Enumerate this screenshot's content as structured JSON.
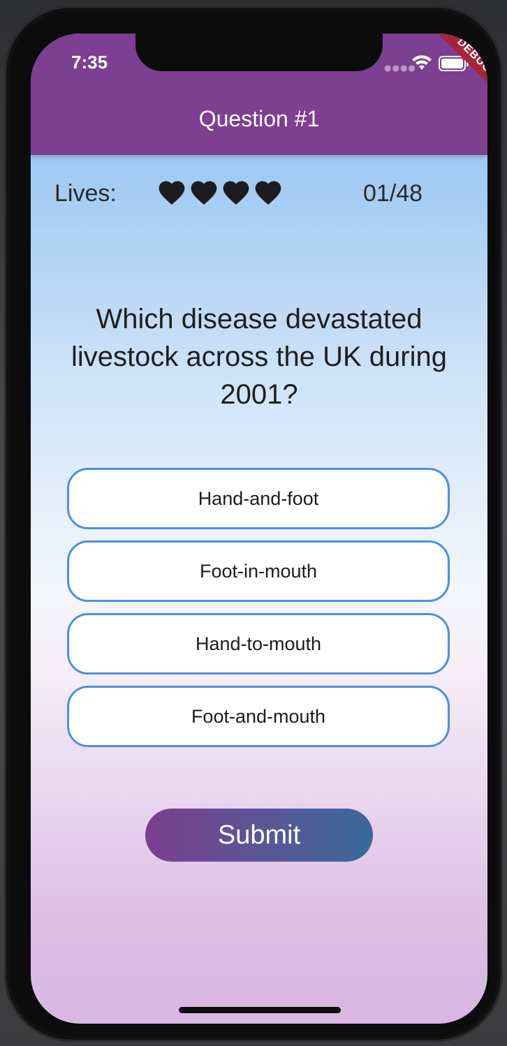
{
  "status_bar": {
    "time": "7:35",
    "icons": [
      "cellular-dots-icon",
      "wifi-icon",
      "battery-icon"
    ]
  },
  "debug_banner": "DEBUG",
  "app_bar": {
    "title": "Question #1",
    "color": "#7d3f90"
  },
  "quiz": {
    "lives_label": "Lives:",
    "lives_count": 4,
    "heart_icon": "heart-icon",
    "progress": "01/48",
    "question": "Which disease devastated livestock across the UK during 2001?",
    "answers": [
      {
        "label": "Hand-and-foot"
      },
      {
        "label": "Foot-in-mouth"
      },
      {
        "label": "Hand-to-mouth"
      },
      {
        "label": "Foot-and-mouth"
      }
    ],
    "submit_label": "Submit"
  },
  "colors": {
    "answer_border": "#4a90e2",
    "submit_gradient": [
      "#7c3f8f",
      "#3a6a9c"
    ],
    "background_top": "#94c2f2",
    "background_bottom": "#d8b8e3"
  }
}
